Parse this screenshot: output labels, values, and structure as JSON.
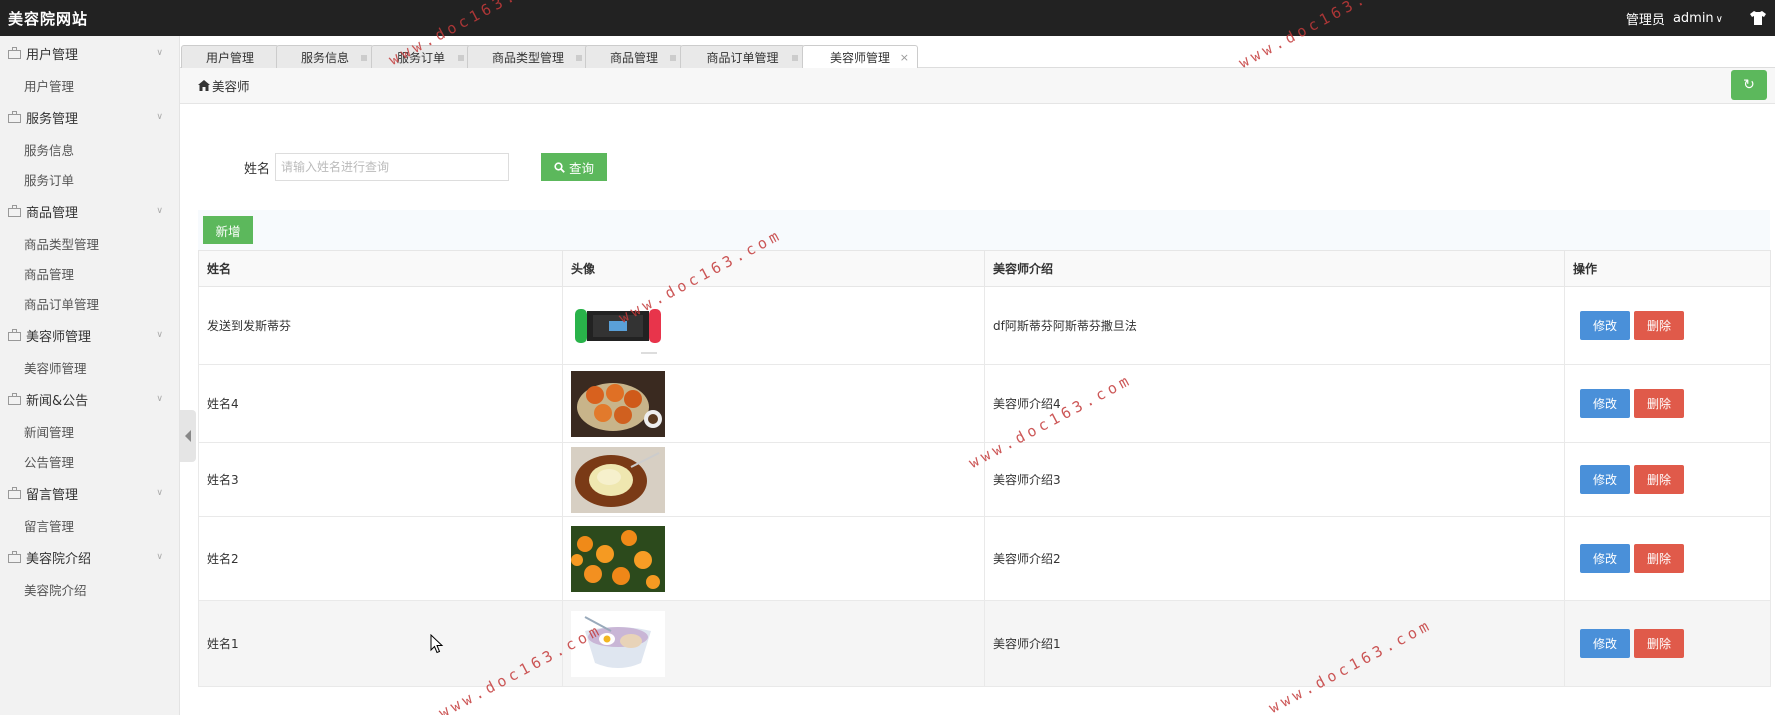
{
  "app": {
    "title": "美容院网站",
    "role": "管理员",
    "user": "admin"
  },
  "sidebar": [
    {
      "title": "用户管理",
      "items": [
        "用户管理"
      ]
    },
    {
      "title": "服务管理",
      "items": [
        "服务信息",
        "服务订单"
      ]
    },
    {
      "title": "商品管理",
      "items": [
        "商品类型管理",
        "商品管理",
        "商品订单管理"
      ]
    },
    {
      "title": "美容师管理",
      "items": [
        "美容师管理"
      ]
    },
    {
      "title": "新闻&公告",
      "items": [
        "新闻管理",
        "公告管理"
      ]
    },
    {
      "title": "留言管理",
      "items": [
        "留言管理"
      ]
    },
    {
      "title": "美容院介绍",
      "items": [
        "美容院介绍"
      ]
    }
  ],
  "tabs": [
    "用户管理",
    "服务信息",
    "服务订单",
    "商品类型管理",
    "商品管理",
    "商品订单管理",
    "美容师管理"
  ],
  "active_tab": "美容师管理",
  "breadcrumb": "美容师",
  "search": {
    "label": "姓名",
    "placeholder": "请输入姓名进行查询",
    "button": "查询"
  },
  "add_button": "新增",
  "table": {
    "columns": [
      "姓名",
      "头像",
      "美容师介绍",
      "操作"
    ],
    "rows": [
      {
        "name": "发送到发斯蒂芬",
        "intro": "df阿斯蒂芬阿斯蒂芬撒旦法",
        "avatar": "game-console"
      },
      {
        "name": "姓名4",
        "intro": "美容师介绍4",
        "avatar": "crabs"
      },
      {
        "name": "姓名3",
        "intro": "美容师介绍3",
        "avatar": "dessert"
      },
      {
        "name": "姓名2",
        "intro": "美容师介绍2",
        "avatar": "oranges"
      },
      {
        "name": "姓名1",
        "intro": "美容师介绍1",
        "avatar": "noodles"
      }
    ],
    "edit_label": "修改",
    "delete_label": "删除"
  },
  "watermark": "www.doc163.com"
}
